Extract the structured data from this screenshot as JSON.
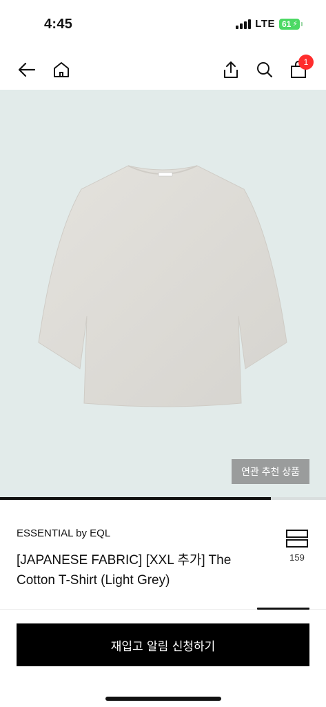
{
  "status_bar": {
    "time": "4:45",
    "network": "LTE",
    "battery": "61"
  },
  "nav": {
    "back_icon": "arrow-left-icon",
    "home_icon": "home-icon",
    "share_icon": "share-icon",
    "search_icon": "search-icon",
    "cart_icon": "shopping-bag-icon",
    "cart_count": "1"
  },
  "product_image": {
    "alt_icon": "t-shirt-image",
    "related_label": "연관 추천 상품",
    "carousel_progress": 0.83
  },
  "product": {
    "brand": "ESSENTIAL by EQL",
    "title": "[JAPANESE FABRIC] [XXL 추가] The Cotton T-Shirt (Light Grey)",
    "wish_icon": "wishlist-icon",
    "wish_count": "159"
  },
  "cta": {
    "label": "재입고 알림 신청하기"
  },
  "colors": {
    "image_background": "#e2ebea",
    "badge": "#ff2d2d",
    "cta_background": "#000000",
    "battery": "#4cd964"
  }
}
